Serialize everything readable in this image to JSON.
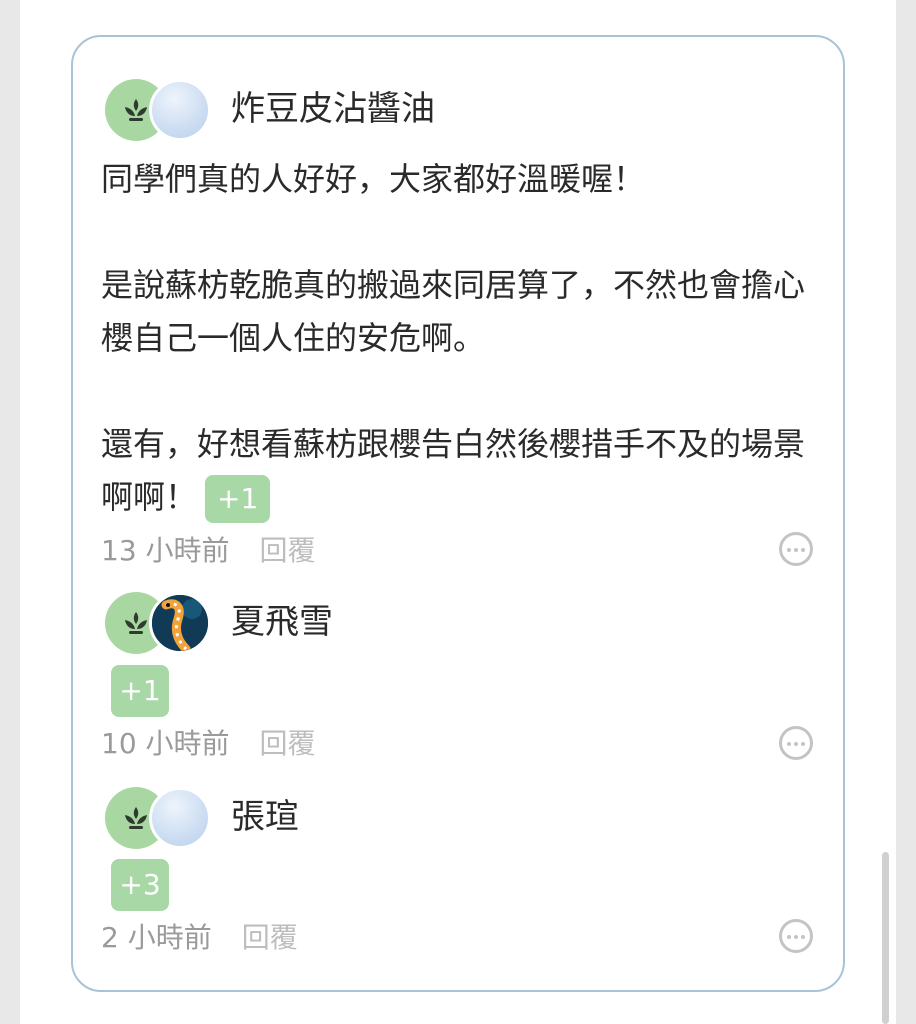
{
  "comments": [
    {
      "name": "炸豆皮沾醬油",
      "paragraphs": [
        "同學們真的人好好，大家都好溫暖喔！",
        "是說蘇枋乾脆真的搬過來同居算了，不然也會擔心櫻自己一個人住的安危啊。",
        "還有，好想看蘇枋跟櫻告白然後櫻措手不及的場景啊啊！"
      ],
      "reaction": "+1",
      "time": "13 小時前",
      "reply_label": "回覆"
    },
    {
      "name": "夏飛雪",
      "reaction": "+1",
      "time": "10 小時前",
      "reply_label": "回覆"
    },
    {
      "name": "張瑄",
      "reaction": "+3",
      "time": "2 小時前",
      "reply_label": "回覆"
    }
  ],
  "icons": {
    "badge_avatar": "sprout-icon",
    "more": "more-options-icon"
  },
  "colors": {
    "card_border": "#a9c3d6",
    "reaction_badge": "#a8d8a6",
    "plant_avatar": "#a8d7a2"
  }
}
